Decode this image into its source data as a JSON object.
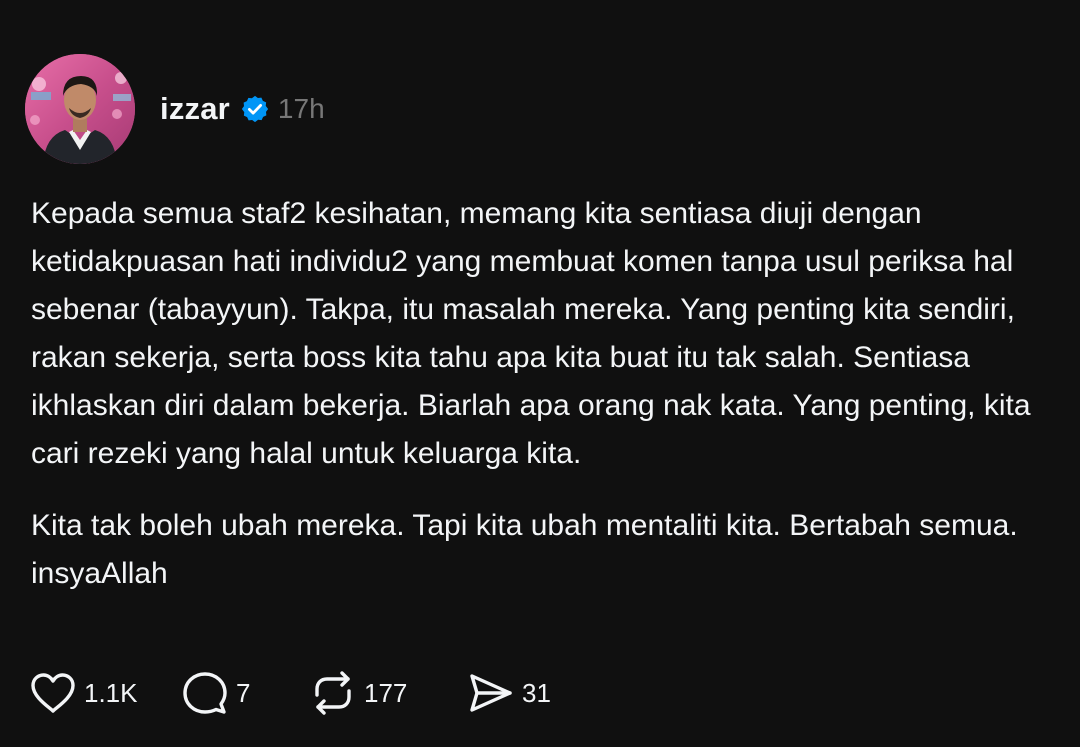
{
  "author": {
    "username": "izzar",
    "verified": true,
    "time": "17h",
    "avatar_icon": "profile-photo",
    "verified_color": "#0095f6"
  },
  "post": {
    "paragraphs": [
      "Kepada semua staf2 kesihatan, memang kita sentiasa diuji dengan ketidakpuasan hati individu2 yang membuat komen tanpa usul periksa hal sebenar (tabayyun). Takpa, itu masalah mereka. Yang penting kita sendiri, rakan sekerja, serta boss kita tahu apa kita buat itu tak salah. Sentiasa ikhlaskan diri dalam bekerja. Biarlah apa orang nak kata. Yang penting, kita cari rezeki yang halal untuk keluarga kita.",
      "Kita tak boleh ubah mereka. Tapi kita ubah mentaliti kita. Bertabah semua. insyaAllah"
    ]
  },
  "actions": {
    "likes": "1.1K",
    "replies": "7",
    "reposts": "177",
    "shares": "31",
    "like_icon": "heart-icon",
    "reply_icon": "comment-bubble-icon",
    "repost_icon": "repost-icon",
    "share_icon": "send-icon"
  },
  "colors": {
    "background": "#101010",
    "text": "#f3f5f7",
    "muted": "#777777"
  }
}
